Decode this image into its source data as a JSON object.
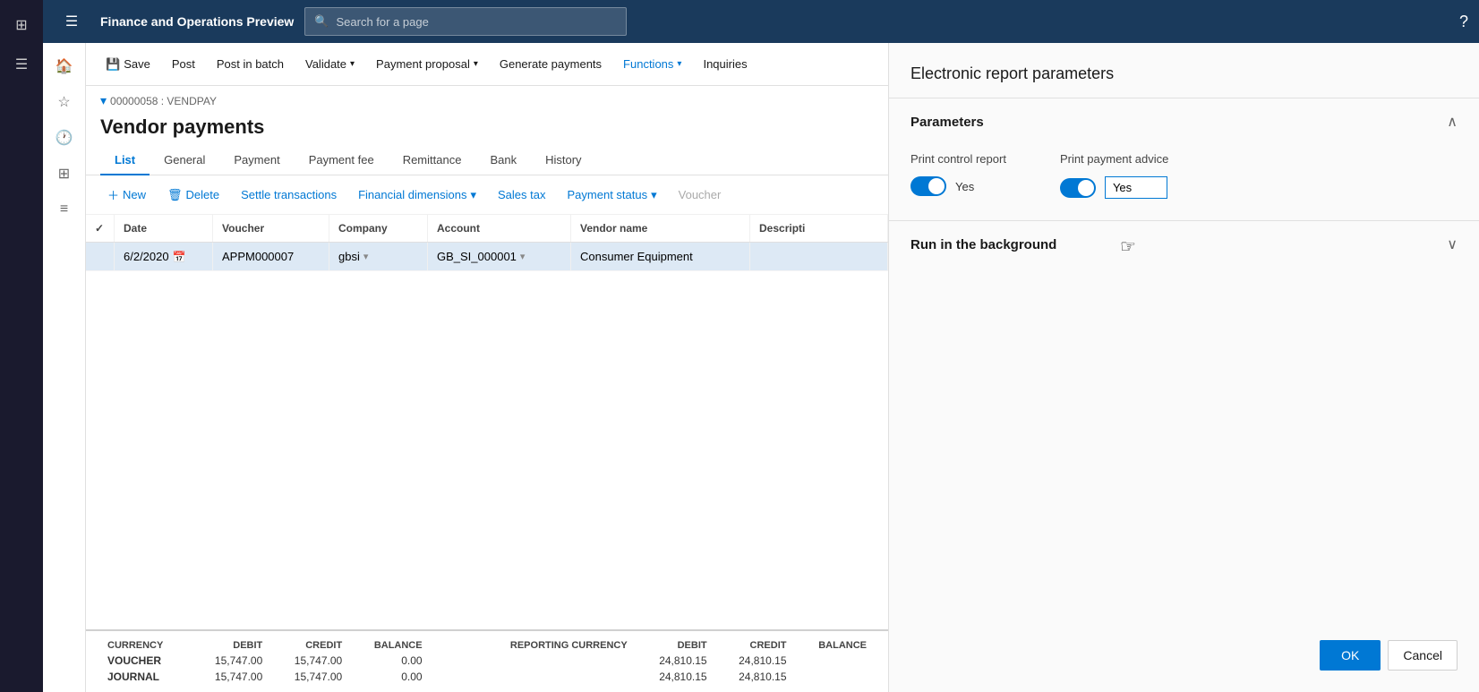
{
  "app": {
    "title": "Finance and Operations Preview",
    "search_placeholder": "Search for a page"
  },
  "nav_rail": {
    "icons": [
      "apps",
      "home",
      "star",
      "history",
      "grid",
      "list"
    ]
  },
  "toolbar": {
    "save_label": "Save",
    "post_label": "Post",
    "post_batch_label": "Post in batch",
    "validate_label": "Validate",
    "payment_proposal_label": "Payment proposal",
    "generate_payments_label": "Generate payments",
    "functions_label": "Functions",
    "inquiries_label": "Inquiries"
  },
  "breadcrumb": {
    "text": "00000058 : VENDPAY"
  },
  "page": {
    "title": "Vendor payments"
  },
  "tabs": [
    {
      "label": "List",
      "active": true
    },
    {
      "label": "General",
      "active": false
    },
    {
      "label": "Payment",
      "active": false
    },
    {
      "label": "Payment fee",
      "active": false
    },
    {
      "label": "Remittance",
      "active": false
    },
    {
      "label": "Bank",
      "active": false
    },
    {
      "label": "History",
      "active": false
    }
  ],
  "actions": {
    "new_label": "New",
    "delete_label": "Delete",
    "settle_label": "Settle transactions",
    "fin_dimensions_label": "Financial dimensions",
    "sales_tax_label": "Sales tax",
    "payment_status_label": "Payment status",
    "voucher_label": "Voucher"
  },
  "grid": {
    "columns": [
      "",
      "Date",
      "Voucher",
      "Company",
      "Account",
      "Vendor name",
      "Descripti"
    ],
    "rows": [
      {
        "checked": false,
        "date": "6/2/2020",
        "voucher": "APPM000007",
        "company": "gbsi",
        "account": "GB_SI_000001",
        "vendor_name": "Consumer Equipment",
        "description": ""
      }
    ]
  },
  "summary": {
    "currency_label": "CURRENCY",
    "reporting_currency_label": "REPORTING CURRENCY",
    "debit_label": "DEBIT",
    "credit_label": "CREDIT",
    "balance_label": "BALANCE",
    "rows": [
      {
        "name": "VOUCHER",
        "debit": "15,747.00",
        "credit": "15,747.00",
        "balance": "0.00",
        "reporting_debit": "24,810.15",
        "reporting_credit": "24,810.15",
        "reporting_balance": ""
      },
      {
        "name": "JOURNAL",
        "debit": "15,747.00",
        "credit": "15,747.00",
        "balance": "0.00",
        "reporting_debit": "24,810.15",
        "reporting_credit": "24,810.15",
        "reporting_balance": ""
      }
    ]
  },
  "right_panel": {
    "title": "Electronic report parameters",
    "parameters_section": {
      "title": "Parameters",
      "print_control_report": {
        "label": "Print control report",
        "value": true,
        "value_text": "Yes"
      },
      "print_payment_advice": {
        "label": "Print payment advice",
        "value": true,
        "value_text": "Yes"
      }
    },
    "run_background_section": {
      "title": "Run in the background"
    },
    "ok_label": "OK",
    "cancel_label": "Cancel"
  }
}
